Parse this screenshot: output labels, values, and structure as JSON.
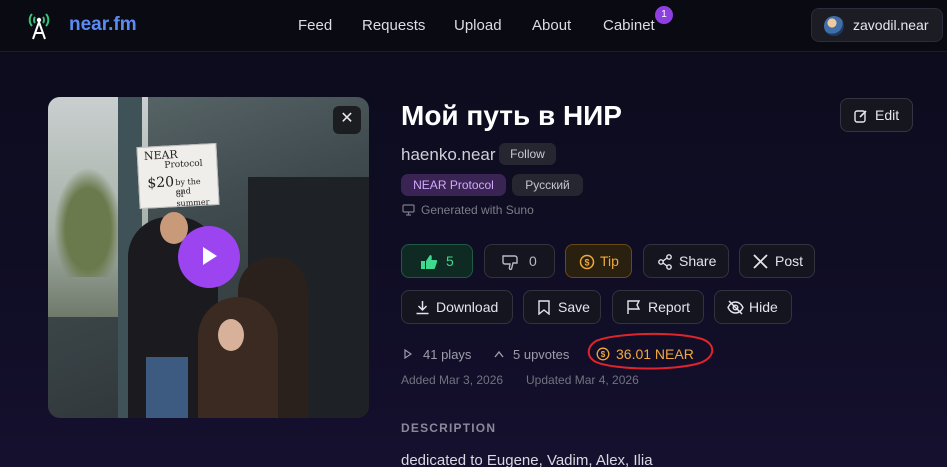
{
  "header": {
    "brand": "near.fm",
    "nav": [
      {
        "label": "Feed"
      },
      {
        "label": "Requests"
      },
      {
        "label": "Upload"
      },
      {
        "label": "About"
      },
      {
        "label": "Cabinet"
      }
    ],
    "cabinet_badge": "1",
    "user": "zavodil.near"
  },
  "cover": {
    "sign_lines": [
      "NEAR",
      "Protocol",
      "$20",
      "by the end",
      "of summer"
    ]
  },
  "track": {
    "title": "Мой путь в НИР",
    "edit_label": "Edit",
    "artist": "haenko.near",
    "follow_label": "Follow",
    "tags": [
      "NEAR Protocol",
      "Русский"
    ],
    "generated": "Generated with Suno"
  },
  "actions": {
    "likes": "5",
    "dislikes": "0",
    "tip": "Tip",
    "share": "Share",
    "post": "Post",
    "download": "Download",
    "save": "Save",
    "report": "Report",
    "hide": "Hide"
  },
  "stats": {
    "plays": "41 plays",
    "upvotes": "5 upvotes",
    "earned": "36.01 NEAR",
    "added": "Added Mar 3, 2026",
    "updated": "Updated Mar 4, 2026"
  },
  "description": {
    "heading": "DESCRIPTION",
    "text": "dedicated to Eugene, Vadim, Alex, Ilia"
  },
  "colors": {
    "brand": "#5b8cf5",
    "accent_purple": "#9b44f0",
    "like_green": "#3fd88f",
    "tip_orange": "#f0a93b",
    "annotation_red": "#e0242b"
  }
}
